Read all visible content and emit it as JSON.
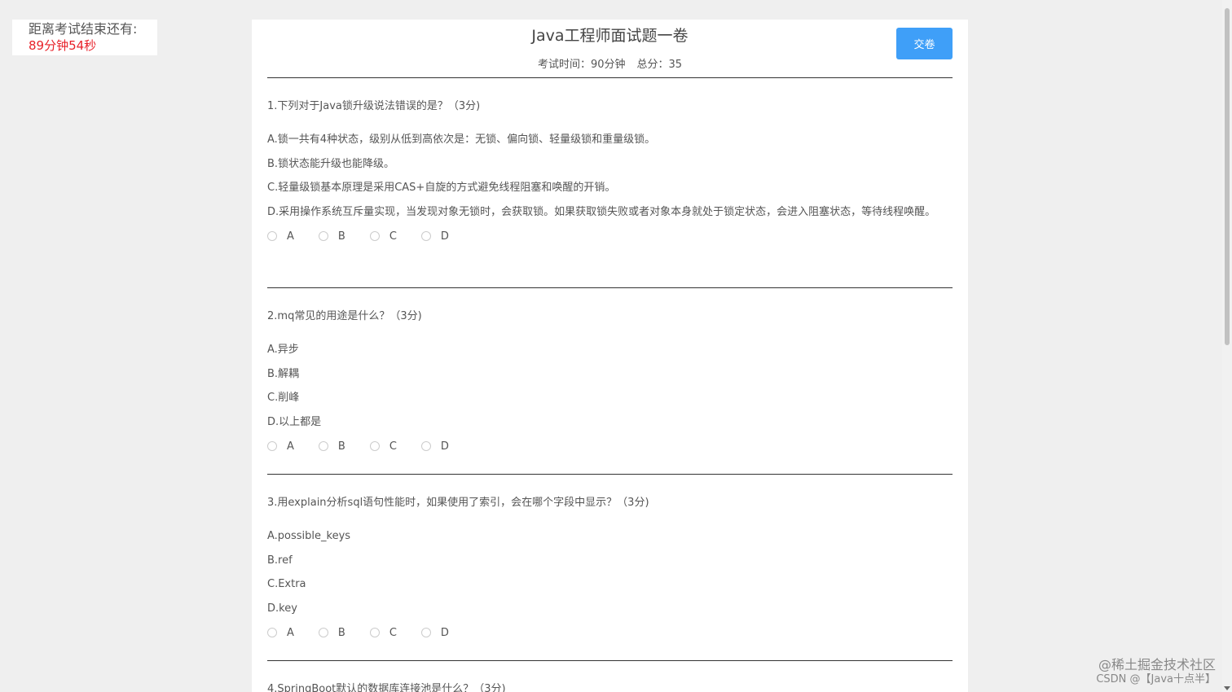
{
  "timer": {
    "label": "距离考试结束还有:",
    "value": "89分钟54秒"
  },
  "paper": {
    "title": "Java工程师面试题一卷",
    "time": "考试时间：90分钟",
    "total": "总分：35",
    "submit_label": "交卷"
  },
  "questions": [
    {
      "stem": "1.下列对于Java锁升级说法错误的是？（3分)",
      "options": [
        "A.锁一共有4种状态，级别从低到高依次是：无锁、偏向锁、轻量级锁和重量级锁。",
        "B.锁状态能升级也能降级。",
        "C.轻量级锁基本原理是采用CAS+自旋的方式避免线程阻塞和唤醒的开销。",
        "D.采用操作系统互斥量实现，当发现对象无锁时，会获取锁。如果获取锁失败或者对象本身就处于锁定状态，会进入阻塞状态，等待线程唤醒。"
      ],
      "choices": [
        "A",
        "B",
        "C",
        "D"
      ]
    },
    {
      "stem": "2.mq常见的用途是什么？（3分)",
      "options": [
        "A.异步",
        "B.解耦",
        "C.削峰",
        "D.以上都是"
      ],
      "choices": [
        "A",
        "B",
        "C",
        "D"
      ]
    },
    {
      "stem": "3.用explain分析sql语句性能时，如果使用了索引，会在哪个字段中显示？（3分)",
      "options": [
        "A.possible_keys",
        "B.ref",
        "C.Extra",
        "D.key"
      ],
      "choices": [
        "A",
        "B",
        "C",
        "D"
      ]
    },
    {
      "stem": "4.SpringBoot默认的数据库连接池是什么？（3分)"
    }
  ],
  "watermark": {
    "line1": "@稀土掘金技术社区",
    "line2": "CSDN @【Java十点半】"
  }
}
